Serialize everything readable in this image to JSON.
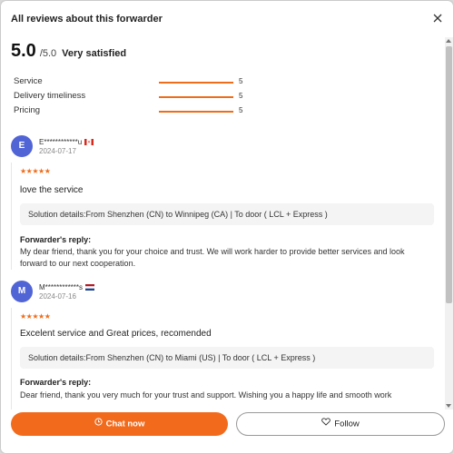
{
  "modal": {
    "title": "All reviews about this forwarder"
  },
  "summary": {
    "score": "5.0",
    "out_of": "/5.0",
    "label": "Very satisfied"
  },
  "ratings": [
    {
      "label": "Service",
      "value": "5",
      "fraction": 1.0
    },
    {
      "label": "Delivery timeliness",
      "value": "5",
      "fraction": 1.0
    },
    {
      "label": "Pricing",
      "value": "5",
      "fraction": 1.0
    }
  ],
  "reviews": [
    {
      "initial": "E",
      "user": "E************u",
      "flag": "canada-flag",
      "date": "2024-07-17",
      "stars": "★★★★★",
      "text": "love the service",
      "solution": "Solution details:From Shenzhen (CN) to Winnipeg (CA)  | To door ( LCL + Express )",
      "reply_title": "Forwarder's reply:",
      "reply_text": "My dear friend, thank you for your choice and trust. We will work harder to provide better services and look forward to our next cooperation."
    },
    {
      "initial": "M",
      "user": "M************s",
      "flag": "netherlands-flag",
      "date": "2024-07-16",
      "stars": "★★★★★",
      "text": "Excelent service and Great prices, recomended",
      "solution": "Solution details:From Shenzhen (CN) to Miami (US)  | To door ( LCL + Express )",
      "reply_title": "Forwarder's reply:",
      "reply_text": "Dear friend, thank you very much for your trust and support. Wishing you a happy life and smooth work"
    }
  ],
  "footer": {
    "chat_label": "Chat now",
    "follow_label": "Follow"
  },
  "colors": {
    "accent": "#f26b1d",
    "avatar": "#5164d6",
    "star": "#ef6c1a"
  }
}
